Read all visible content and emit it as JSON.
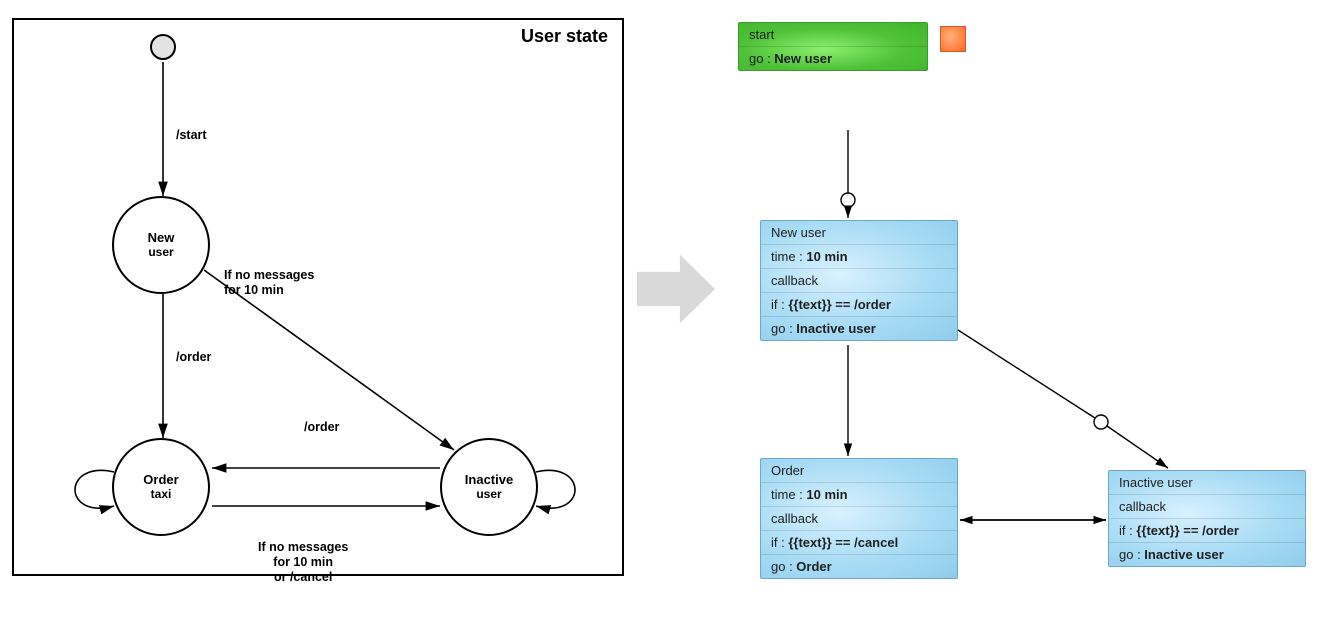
{
  "left": {
    "title": "User state",
    "labels": {
      "start": "/start",
      "order_down": "/order",
      "order_mid": "/order",
      "no_msg_top": "If no messages\nfor 10 min",
      "no_msg_bottom": "If no messages\nfor 10 min\nor /cancel"
    },
    "states": {
      "new": {
        "l1": "New",
        "l2": "user"
      },
      "order": {
        "l1": "Order",
        "l2": "taxi"
      },
      "inactive": {
        "l1": "Inactive",
        "l2": "user"
      }
    }
  },
  "right": {
    "start": {
      "title": "start",
      "go_key": "go : ",
      "go_val": "New user"
    },
    "newuser": {
      "title": "New user",
      "time_key": "time : ",
      "time_val": "10 min",
      "callback": "callback",
      "if_key": "if : ",
      "if_val": "{{text}} == /order",
      "go_key": "go : ",
      "go_val": "Inactive user"
    },
    "order": {
      "title": "Order",
      "time_key": "time : ",
      "time_val": "10 min",
      "callback": "callback",
      "if_key": "if : ",
      "if_val": "{{text}} == /cancel",
      "go_key": "go : ",
      "go_val": "Order"
    },
    "inactive": {
      "title": "Inactive user",
      "callback": "callback",
      "if_key": "if : ",
      "if_val": "{{text}} == /order",
      "go_key": "go : ",
      "go_val": "Inactive user"
    }
  }
}
